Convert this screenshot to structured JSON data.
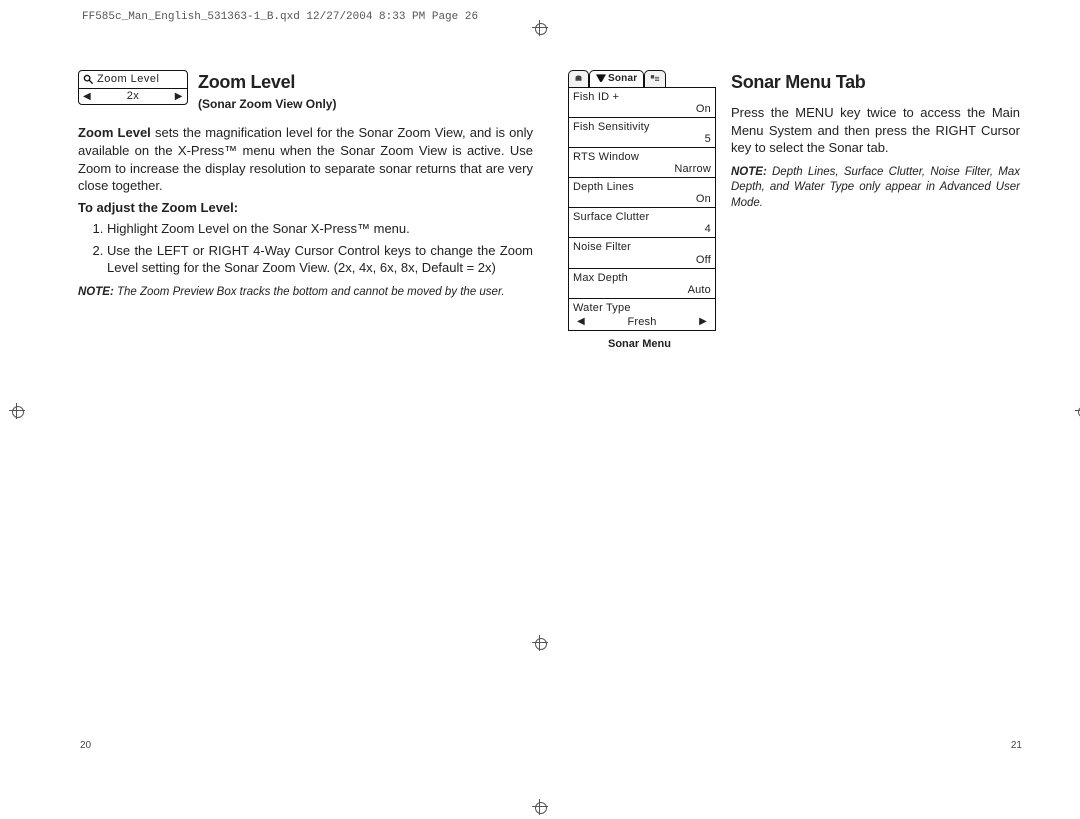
{
  "header": "FF585c_Man_English_531363-1_B.qxd  12/27/2004  8:33 PM  Page 26",
  "left_page_num": "20",
  "right_page_num": "21",
  "zoom_box": {
    "title": "Zoom Level",
    "value": "2x"
  },
  "zoom_section": {
    "title": "Zoom Level",
    "subtitle": "(Sonar Zoom View Only)",
    "lead_bold": "Zoom Level",
    "lead_rest": " sets the magnification level for the Sonar Zoom View, and is only available on the X-Press™ menu when the Sonar Zoom View is active. Use Zoom to increase the display resolution to separate sonar returns that are very close together.",
    "adjust_head": "To adjust the Zoom Level:",
    "steps": [
      "Highlight Zoom Level on the Sonar X-Press™ menu.",
      "Use the LEFT or RIGHT 4-Way Cursor Control keys to change the Zoom Level setting for the Sonar Zoom View. (2x, 4x, 6x, 8x, Default = 2x)"
    ],
    "note_label": "NOTE:",
    "note_body": " The Zoom Preview Box tracks the bottom and cannot be moved by the user."
  },
  "sonar_tab_label": "Sonar",
  "sonar_menu": {
    "rows": [
      {
        "label": "Fish ID +",
        "val": "On"
      },
      {
        "label": "Fish Sensitivity",
        "val": "5"
      },
      {
        "label": "RTS Window",
        "val": "Narrow"
      },
      {
        "label": "Depth Lines",
        "val": "On"
      },
      {
        "label": "Surface Clutter",
        "val": "4"
      },
      {
        "label": "Noise Filter",
        "val": "Off"
      },
      {
        "label": "Max Depth",
        "val": "Auto"
      }
    ],
    "last_label": "Water Type",
    "last_val": "Fresh",
    "caption": "Sonar Menu"
  },
  "sonar_section": {
    "title": "Sonar Menu Tab",
    "body": "Press the MENU key twice to access the Main Menu System and then press the RIGHT Cursor key to select the Sonar tab.",
    "note_label": "NOTE:",
    "note_body": " Depth Lines, Surface Clutter, Noise Filter, Max Depth, and Water Type only appear in Advanced User Mode."
  }
}
